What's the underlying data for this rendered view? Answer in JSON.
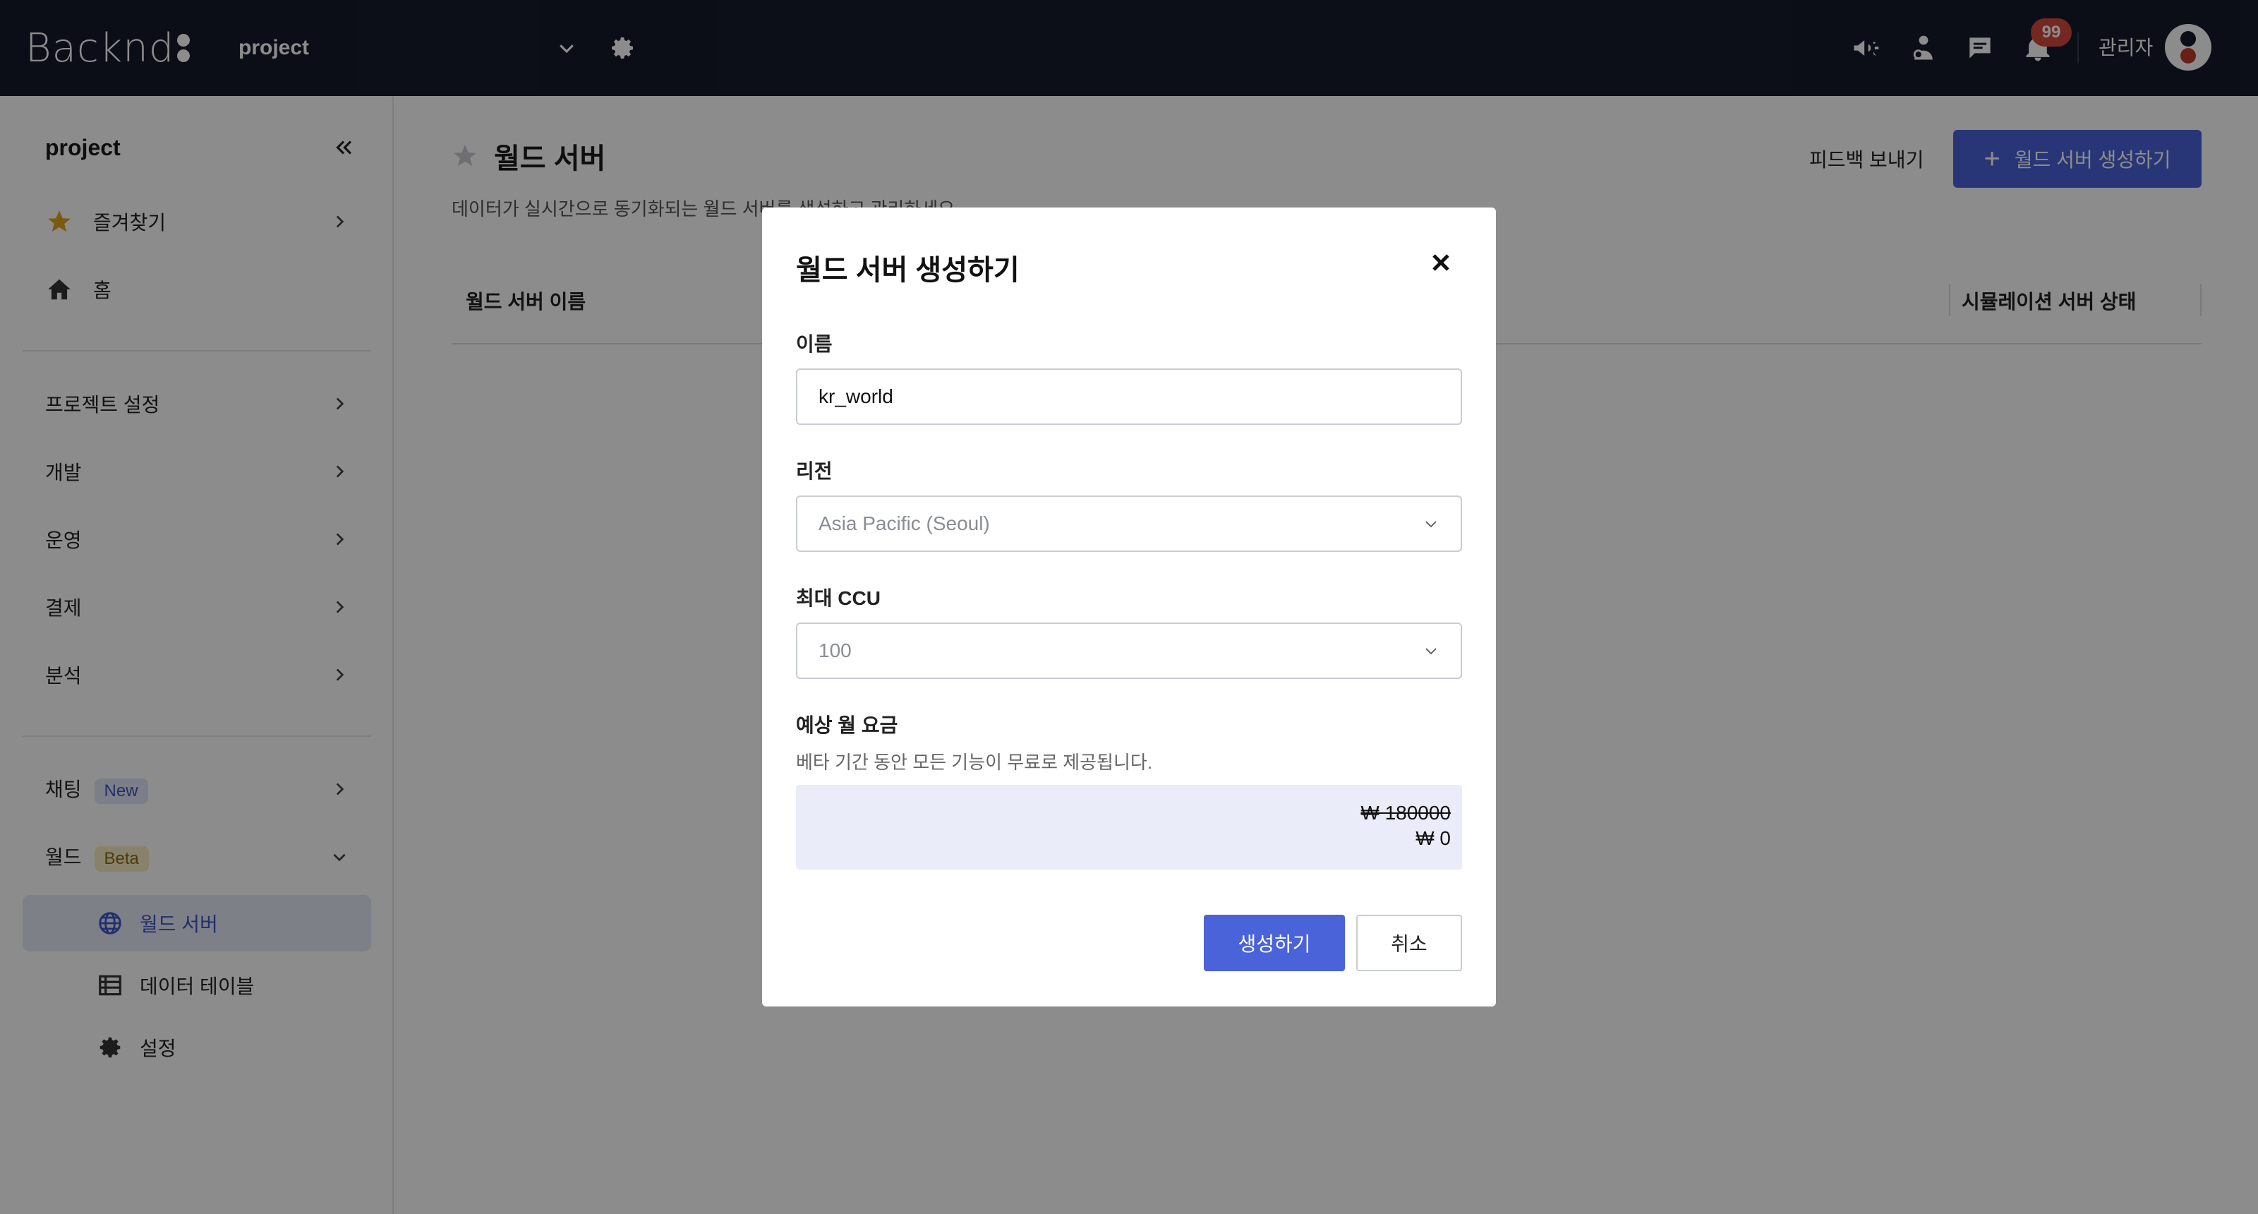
{
  "topbar": {
    "logo_text": "Backnd",
    "project_name": "project",
    "notification_count": "99",
    "admin_name": "관리자"
  },
  "sidebar": {
    "project_name": "project",
    "items": {
      "favorites": "즐겨찾기",
      "home": "홈",
      "project_settings": "프로젝트 설정",
      "development": "개발",
      "operations": "운영",
      "payment": "결제",
      "analytics": "분석",
      "chatting": "채팅",
      "chatting_badge": "New",
      "world": "월드",
      "world_badge": "Beta",
      "world_server": "월드 서버",
      "data_table": "데이터 테이블",
      "settings": "설정"
    }
  },
  "main": {
    "title": "월드 서버",
    "description": "데이터가 실시간으로 동기화되는 월드 서버를 생성하고 관리하세요.",
    "feedback_label": "피드백 보내기",
    "create_label": "월드 서버 생성하기",
    "columns": [
      "월드 서버 이름",
      "시뮬레이션 서버 상태"
    ]
  },
  "modal": {
    "title": "월드 서버 생성하기",
    "name_label": "이름",
    "name_value": "kr_world",
    "region_label": "리전",
    "region_value": "Asia Pacific (Seoul)",
    "ccu_label": "최대 CCU",
    "ccu_value": "100",
    "price_label": "예상 월 요금",
    "price_help": "베타 기간 동안 모든 기능이 무료로 제공됩니다.",
    "price_original": "₩ 180000",
    "price_current": "₩ 0",
    "create_button": "생성하기",
    "cancel_button": "취소"
  },
  "colors": {
    "topbar_bg": "#151a2b",
    "accent": "#4a63d9",
    "badge_red": "#d6473d"
  }
}
